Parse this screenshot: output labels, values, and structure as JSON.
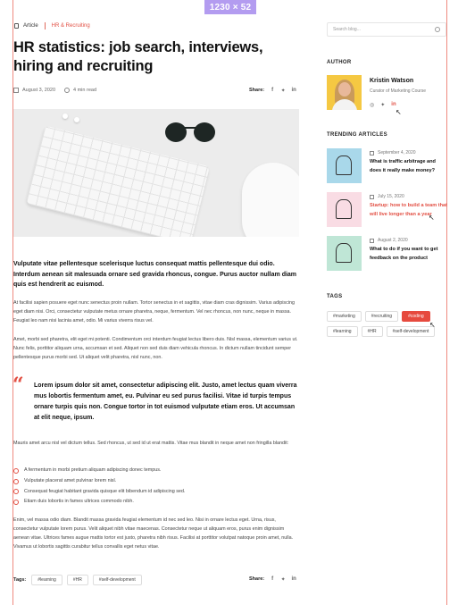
{
  "badge": "1230 × 52",
  "breadcrumb": {
    "type": "Article",
    "category": "HR & Recruiting"
  },
  "article": {
    "title": "HR statistics: job search,  interviews, hiring and recruiting",
    "date": "August 3, 2020",
    "read_time": "4 min read",
    "share_label": "Share:",
    "lead": "Vulputate vitae pellentesque scelerisque luctus consequat mattis pellentesque dui odio. Interdum aenean sit malesuada ornare sed gravida rhoncus, congue. Purus auctor nullam diam quis est hendrerit ac euismod.",
    "p1": "At facilisi sapien posuere eget nunc senectus proin nullam. Tortor senectus in et sagittis, vitae diam cras dignissim. Varius adipiscing eget diam nisi. Orci, consectetur vulputate metus ornare pharetra, neque, fermentum. Vel nec rhoncus, non nunc, neque in massa. Feugiat leo nam nisi lacinia amet, odio. Mi varius viverra risus vel.",
    "p2": "Amet, morbi sed pharetra, elit eget mi potenti. Condimentum orci interdum feugiat lectus libero duis. Nisl massa, elementum varius ut. Nunc felis, porttitor aliquam urna, accumsan et sed. Aliquet non sed duis diam vehicula rhoncus. In dictum nullam tincidunt semper pellentesque purus morbi sed. Ut aliquet velit pharetra, nisl nunc, non.",
    "quote": "Lorem ipsum dolor sit amet, consectetur adipiscing elit. Justo, amet lectus quam viverra mus lobortis fermentum amet, eu. Pulvinar eu sed purus  facilisi. Vitae id turpis tempus ornare turpis quis non. Congue tortor in tot euismod vulputate etiam eros. Ut accumsan at elit neque, ipsum.",
    "p3": "Mauris amet arcu nisl vel dictum tellus. Sed rhoncus, ut sed id ut erat mattis. Vitae mus blandit in neque amet non fringilla blandit:",
    "checklist": [
      "A fermentum in morbi pretium aliquam adipiscing donec tempus.",
      "Vulputate placerat amet pulvinar lorem nisl.",
      "Consequat feugiat habitant gravida quisque elit bibendum id adipiscing sed.",
      "Etiam duis lobortis in fames ultrices commodo nibh."
    ],
    "p4": "Enim, vel massa odio diam. Blandit massa gravida feugiat elementum id nec sed leo. Nisi in ornare lectus eget. Urna, risus, consectetur vulputate lorem purus. Velit aliquet nibh vitae maecenas. Consectetur neque ut aliquam eros, purus enim dignissim aenean vitae. Ultrices fames augue mattis tortor est justo, pharetra nibh risus. Facilisi at porttitor volutpat natoque proin amet, nulla. Vivamus ut lobortis sagittis curabitur tellus convallis eget netus vitae.",
    "tags_label": "Tags:",
    "tags": [
      "#learning",
      "#HR",
      "#self-development"
    ]
  },
  "search": {
    "placeholder": "Search blog..."
  },
  "author": {
    "heading": "AUTHOR",
    "name": "Kristin Watson",
    "role": "Curator of Marketing Course"
  },
  "trending": {
    "heading": "TRENDING ARTICLES",
    "items": [
      {
        "date": "September 4, 2020",
        "title": "What is traffic arbitrage and does it really make money?"
      },
      {
        "date": "July 15, 2020",
        "title": "Startup: how to build a team that will live longer than a year"
      },
      {
        "date": "August 2, 2020",
        "title": "What to do if you want to get feedback on the product"
      }
    ]
  },
  "side_tags": {
    "heading": "TAGS",
    "items": [
      "#marketing",
      "#recruiting",
      "#coding",
      "#learning",
      "#HR",
      "#self-development"
    ],
    "active": "#coding"
  },
  "colors": {
    "accent": "#e24f43",
    "frame": "#ef8a80",
    "badge": "#b39cf0"
  }
}
